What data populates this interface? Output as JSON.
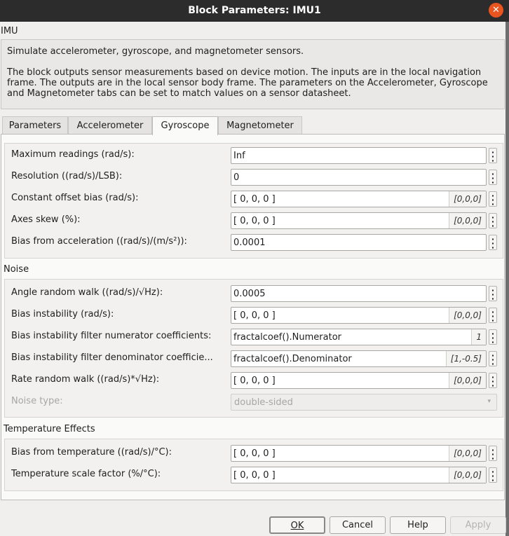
{
  "window": {
    "title": "Block Parameters: IMU1",
    "close": "✕"
  },
  "block": {
    "name": "IMU",
    "description_line1": "Simulate accelerometer, gyroscope, and magnetometer sensors.",
    "description_line2": "The block outputs sensor measurements based on device motion. The inputs are in the local navigation frame. The outputs are in the local sensor body frame. The parameters on the Accelerometer, Gyroscope and Magnetometer tabs can be set to match values on a sensor datasheet."
  },
  "tabs": [
    {
      "label": "Parameters",
      "active": false
    },
    {
      "label": "Accelerometer",
      "active": false
    },
    {
      "label": "Gyroscope",
      "active": true
    },
    {
      "label": "Magnetometer",
      "active": false
    }
  ],
  "main_group": {
    "rows": [
      {
        "label": "Maximum readings (rad/s):",
        "value": "Inf",
        "evaluated": ""
      },
      {
        "label": "Resolution ((rad/s)/LSB):",
        "value": "0",
        "evaluated": ""
      },
      {
        "label": "Constant offset bias (rad/s):",
        "value": "[ 0, 0, 0 ]",
        "evaluated": "[0,0,0]"
      },
      {
        "label": "Axes skew (%):",
        "value": "[ 0, 0, 0 ]",
        "evaluated": "[0,0,0]"
      },
      {
        "label": "Bias from acceleration ((rad/s)/(m/s²)):",
        "value": "0.0001",
        "evaluated": ""
      }
    ]
  },
  "noise_group": {
    "title": "Noise",
    "rows": [
      {
        "label": "Angle random walk ((rad/s)/√Hz):",
        "value": "0.0005",
        "evaluated": ""
      },
      {
        "label": "Bias instability (rad/s):",
        "value": "[ 0, 0, 0 ]",
        "evaluated": "[0,0,0]"
      },
      {
        "label": "Bias instability filter numerator coefficients:",
        "value": "fractalcoef().Numerator",
        "evaluated": "1"
      },
      {
        "label": "Bias instability filter denominator coefficie...",
        "value": "fractalcoef().Denominator",
        "evaluated": "[1,-0.5]"
      },
      {
        "label": "Rate random walk ((rad/s)*√Hz):",
        "value": "[ 0, 0, 0 ]",
        "evaluated": "[0,0,0]"
      }
    ],
    "noise_type": {
      "label": "Noise type:",
      "value": "double-sided"
    }
  },
  "temp_group": {
    "title": "Temperature Effects",
    "rows": [
      {
        "label": "Bias from temperature ((rad/s)/°C):",
        "value": "[ 0, 0, 0 ]",
        "evaluated": "[0,0,0]"
      },
      {
        "label": "Temperature scale factor (%/°C):",
        "value": "[ 0, 0, 0 ]",
        "evaluated": "[0,0,0]"
      }
    ]
  },
  "buttons": {
    "ok": "OK",
    "cancel": "Cancel",
    "help": "Help",
    "apply": "Apply"
  },
  "icons": {
    "dots": "⋮",
    "arrow": "▾"
  },
  "colors": {
    "titlebar": "#2c2c2c",
    "close": "#e9541f",
    "panel": "#fafaf9"
  }
}
